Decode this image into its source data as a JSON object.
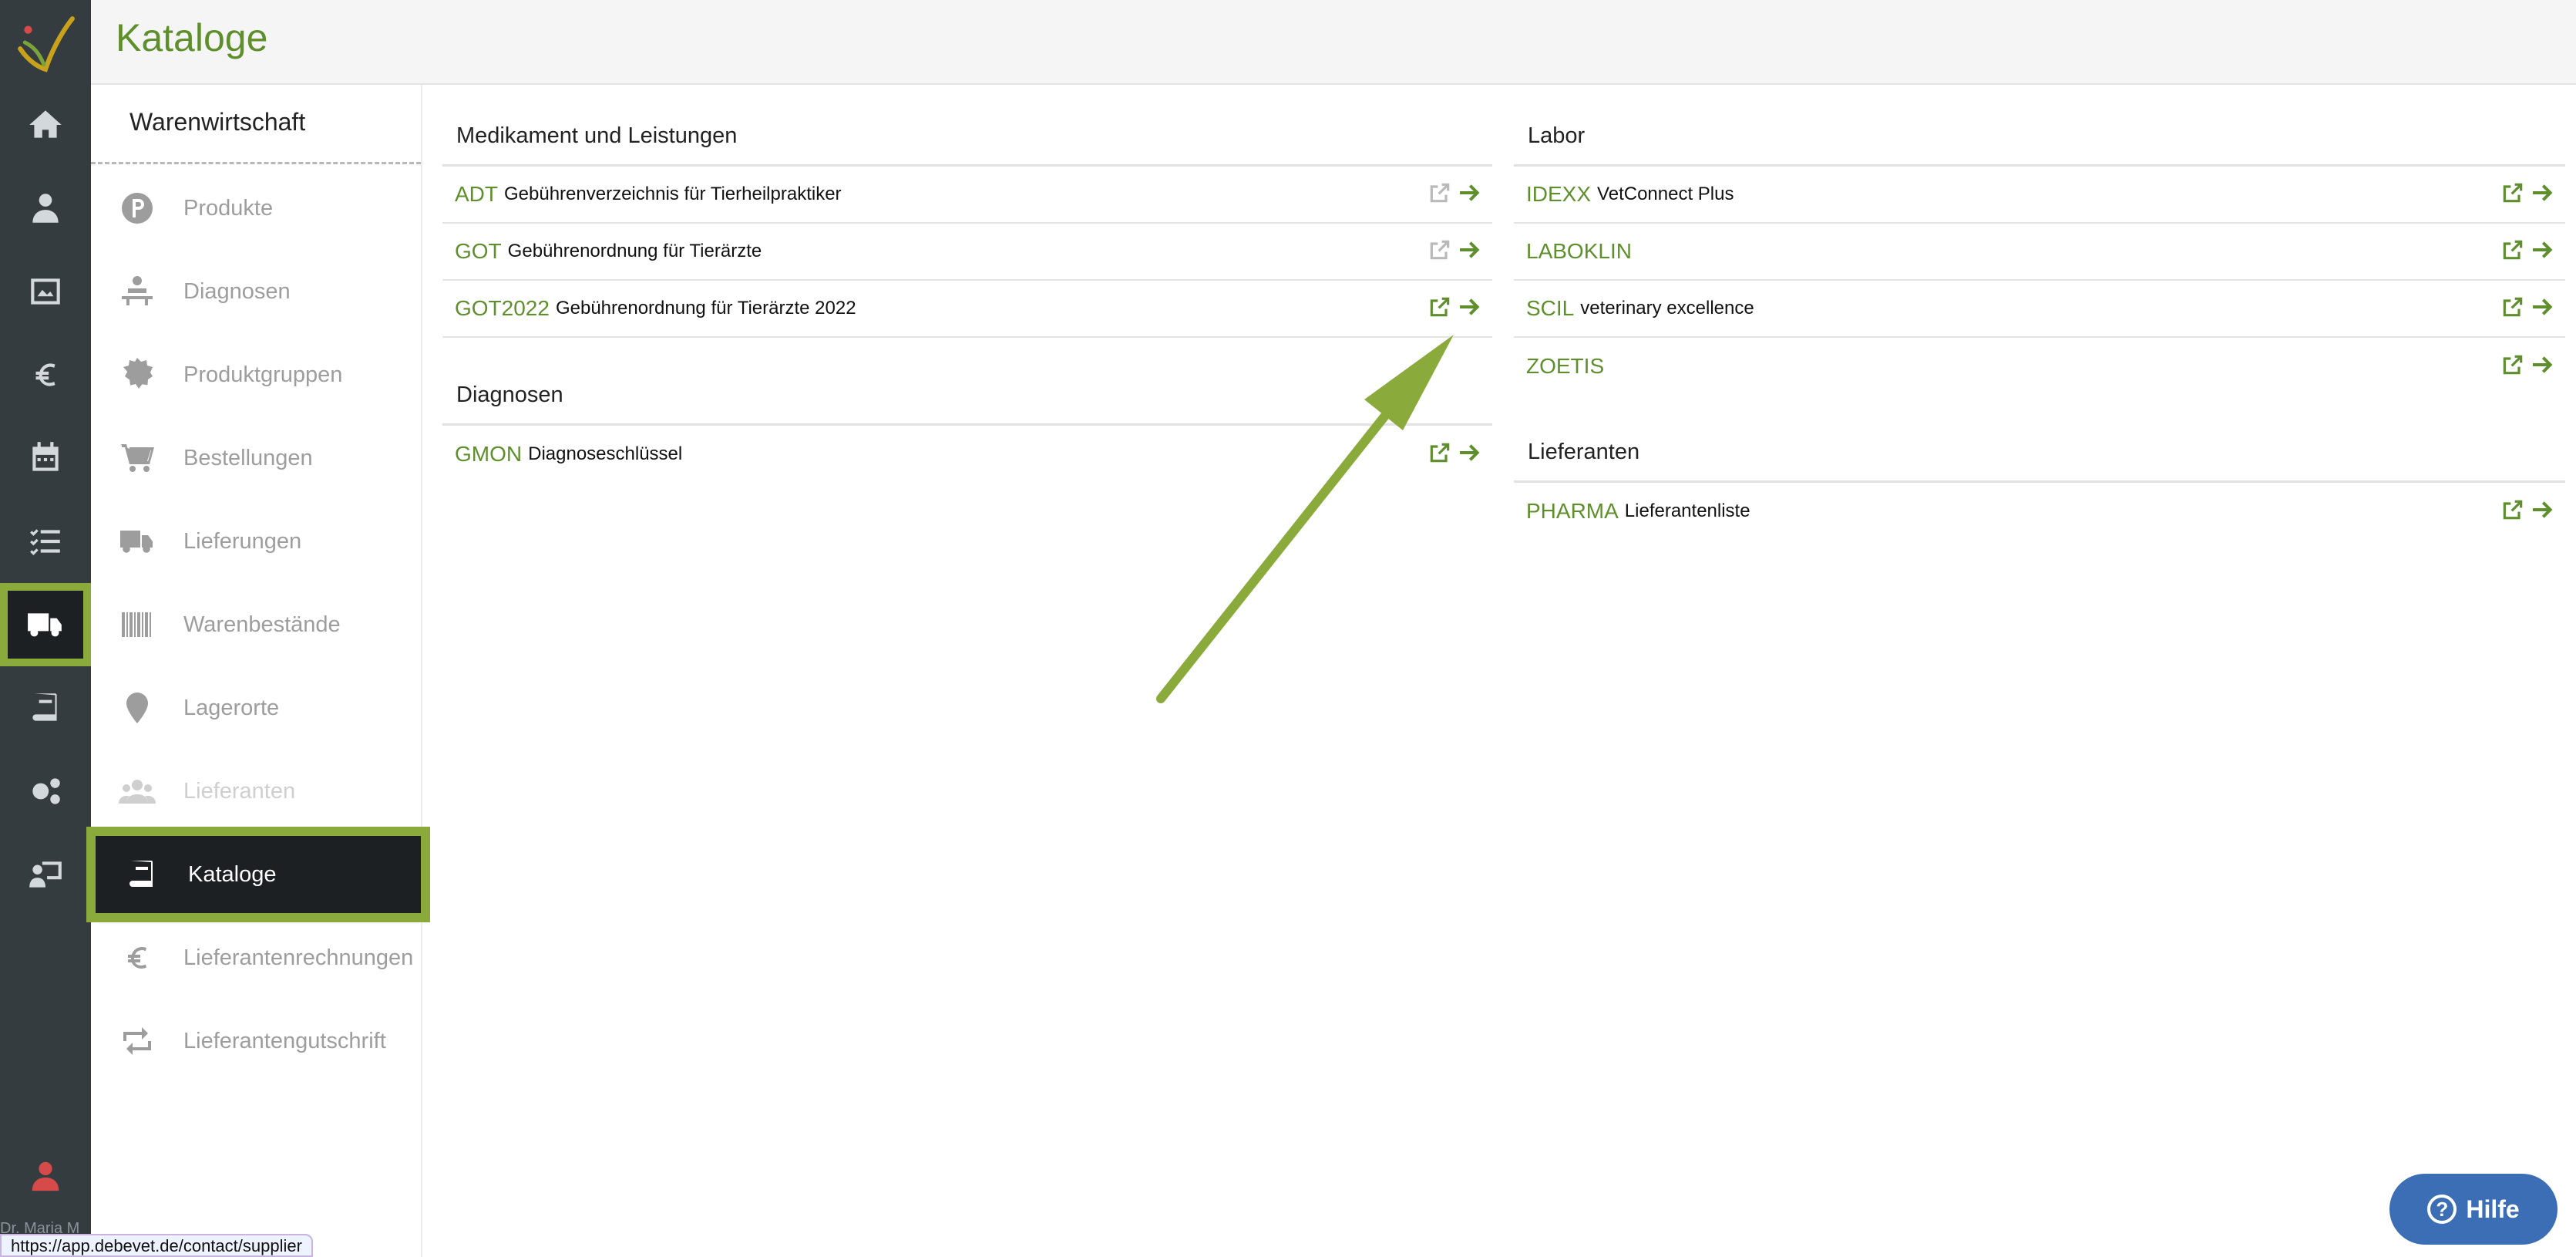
{
  "header": {
    "title": "Kataloge"
  },
  "rail": {
    "username": "Dr. Maria M"
  },
  "subnav": {
    "title": "Warenwirtschaft",
    "items": [
      {
        "label": "Produkte",
        "icon": "parking-icon"
      },
      {
        "label": "Diagnosen",
        "icon": "patient-table-icon"
      },
      {
        "label": "Produktgruppen",
        "icon": "gear-badge-icon"
      },
      {
        "label": "Bestellungen",
        "icon": "cart-icon"
      },
      {
        "label": "Lieferungen",
        "icon": "truck-icon"
      },
      {
        "label": "Warenbestände",
        "icon": "barcode-icon"
      },
      {
        "label": "Lagerorte",
        "icon": "map-pin-icon"
      },
      {
        "label": "Lieferanten",
        "icon": "users-icon"
      },
      {
        "label": "Kataloge",
        "icon": "book-icon"
      },
      {
        "label": "Lieferantenrechnungen",
        "icon": "euro-icon"
      },
      {
        "label": "Lieferantengutschrift",
        "icon": "retweet-icon"
      }
    ]
  },
  "left": {
    "sections": [
      {
        "title": "Medikament und Leistungen",
        "rows": [
          {
            "code": "ADT",
            "desc": "Gebührenverzeichnis für Tierheilpraktiker",
            "ext_enabled": false
          },
          {
            "code": "GOT",
            "desc": "Gebührenordnung für Tierärzte",
            "ext_enabled": false
          },
          {
            "code": "GOT2022",
            "desc": "Gebührenordnung für Tierärzte 2022",
            "ext_enabled": true
          }
        ]
      },
      {
        "title": "Diagnosen",
        "rows": [
          {
            "code": "GMON",
            "desc": "Diagnoseschlüssel",
            "ext_enabled": true
          }
        ]
      }
    ]
  },
  "right": {
    "sections": [
      {
        "title": "Labor",
        "rows": [
          {
            "code": "IDEXX",
            "desc": "VetConnect Plus",
            "ext_enabled": true
          },
          {
            "code": "LABOKLIN",
            "desc": "",
            "ext_enabled": true
          },
          {
            "code": "SCIL",
            "desc": "veterinary excellence",
            "ext_enabled": true
          },
          {
            "code": "ZOETIS",
            "desc": "",
            "ext_enabled": true
          }
        ]
      },
      {
        "title": "Lieferanten",
        "rows": [
          {
            "code": "PHARMA",
            "desc": "Lieferantenliste",
            "ext_enabled": true
          }
        ]
      }
    ]
  },
  "status": {
    "url": "https://app.debevet.de/contact/supplier"
  },
  "help": {
    "label": "Hilfe"
  },
  "colors": {
    "accent": "#8aab3c",
    "link": "#5f8f2d",
    "rail": "#353c40",
    "help": "#3b6eb5"
  }
}
